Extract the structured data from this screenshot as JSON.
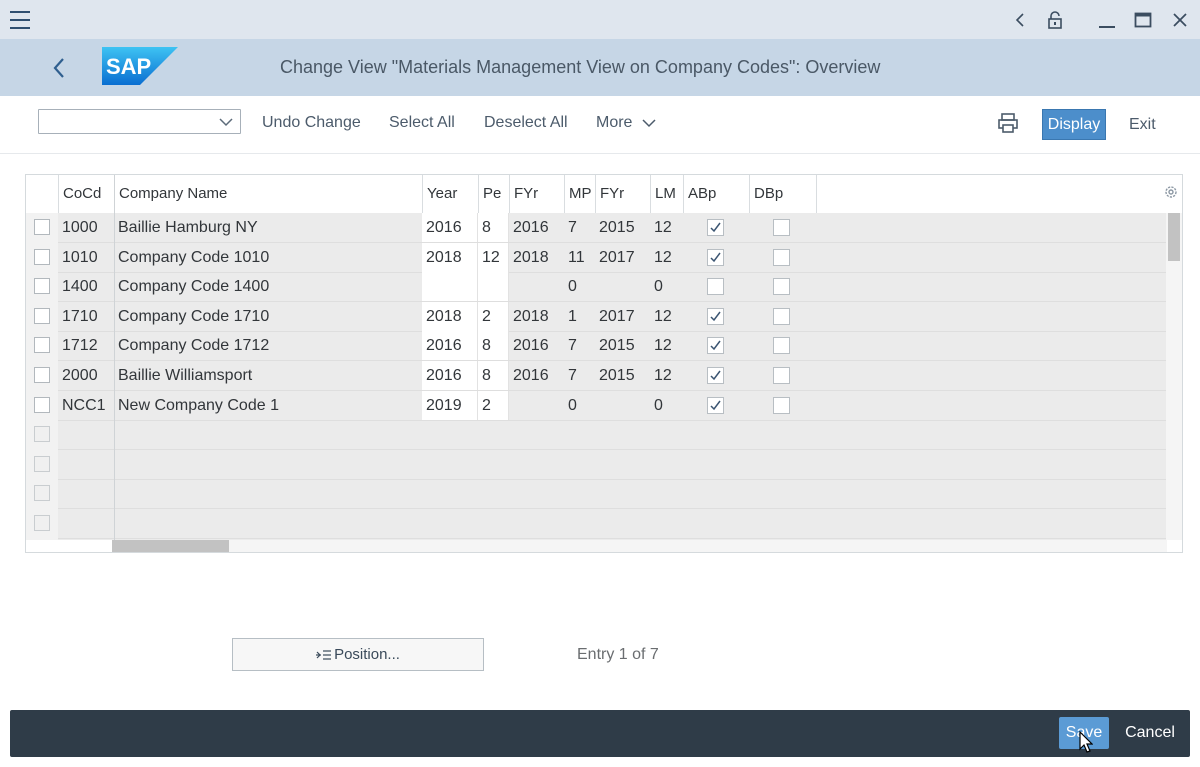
{
  "header": {
    "title": "Change View \"Materials Management View on Company Codes\": Overview",
    "logo_text": "SAP"
  },
  "toolbar": {
    "select_value": "",
    "undo_change": "Undo Change",
    "select_all": "Select All",
    "deselect_all": "Deselect All",
    "more": "More",
    "display": "Display",
    "exit": "Exit"
  },
  "table": {
    "columns": [
      "CoCd",
      "Company Name",
      "Year",
      "Pe",
      "FYr",
      "MP",
      "FYr",
      "LM",
      "ABp",
      "DBp"
    ],
    "rows": [
      {
        "cocd": "1000",
        "name": "Baillie Hamburg NY",
        "year": "2016",
        "pe": "8",
        "fyr": "2016",
        "mp": "7",
        "fyr2": "2015",
        "lm": "12",
        "abp": true,
        "dbp": false
      },
      {
        "cocd": "1010",
        "name": "Company Code 1010",
        "year": "2018",
        "pe": "12",
        "fyr": "2018",
        "mp": "11",
        "fyr2": "2017",
        "lm": "12",
        "abp": true,
        "dbp": false
      },
      {
        "cocd": "1400",
        "name": "Company Code 1400",
        "year": "",
        "pe": "",
        "fyr": "",
        "mp": "0",
        "fyr2": "",
        "lm": "0",
        "abp": false,
        "dbp": false
      },
      {
        "cocd": "1710",
        "name": "Company Code 1710",
        "year": "2018",
        "pe": "2",
        "fyr": "2018",
        "mp": "1",
        "fyr2": "2017",
        "lm": "12",
        "abp": true,
        "dbp": false
      },
      {
        "cocd": "1712",
        "name": "Company Code 1712",
        "year": "2016",
        "pe": "8",
        "fyr": "2016",
        "mp": "7",
        "fyr2": "2015",
        "lm": "12",
        "abp": true,
        "dbp": false
      },
      {
        "cocd": "2000",
        "name": "Baillie Williamsport",
        "year": "2016",
        "pe": "8",
        "fyr": "2016",
        "mp": "7",
        "fyr2": "2015",
        "lm": "12",
        "abp": true,
        "dbp": false
      },
      {
        "cocd": "NCC1",
        "name": "New Company Code 1",
        "year": "2019",
        "pe": "2",
        "fyr": "",
        "mp": "0",
        "fyr2": "",
        "lm": "0",
        "abp": true,
        "dbp": false
      }
    ],
    "empty_rows": 4
  },
  "position_button": "Position...",
  "entry_text": "Entry 1 of 7",
  "footer": {
    "save": "Save",
    "cancel": "Cancel"
  },
  "colors": {
    "header_bg": "#c6d6e6",
    "titlebar_bg": "#dfe6ee",
    "accent": "#4c8ecb",
    "footer_bg": "#2f3c48"
  }
}
